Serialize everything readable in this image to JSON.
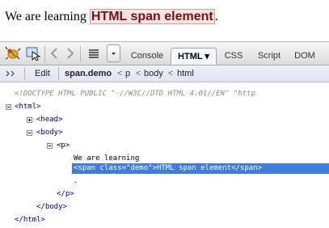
{
  "page": {
    "text_before": "We are learning ",
    "span_text": "HTML span element",
    "text_after": "."
  },
  "toolbar": {
    "tabs": [
      {
        "label": "Console"
      },
      {
        "label": "HTML ▾"
      },
      {
        "label": "CSS"
      },
      {
        "label": "Script"
      },
      {
        "label": "DOM"
      }
    ],
    "active_tab": "HTML"
  },
  "breadcrumb": {
    "edit_label": "Edit",
    "items": [
      "span.demo",
      "p",
      "body",
      "html"
    ],
    "separator": "<"
  },
  "tree": {
    "doctype": "<!DOCTYPE HTML PUBLIC \"-//W3C//DTD HTML 4.01//EN\" \"http",
    "html_open": "<html>",
    "head": "<head>",
    "body_open": "<body>",
    "p_open": "<p>",
    "p_text": "We are learning",
    "selected_node": "<span class=\"demo\">HTML span element</span>",
    "p_text_after": ".",
    "p_close": "</p>",
    "body_close": "</body>",
    "html_close": "</html>"
  },
  "colors": {
    "selection": "#3d7ede",
    "tag": "#000088",
    "span_text": "#7a1010"
  }
}
